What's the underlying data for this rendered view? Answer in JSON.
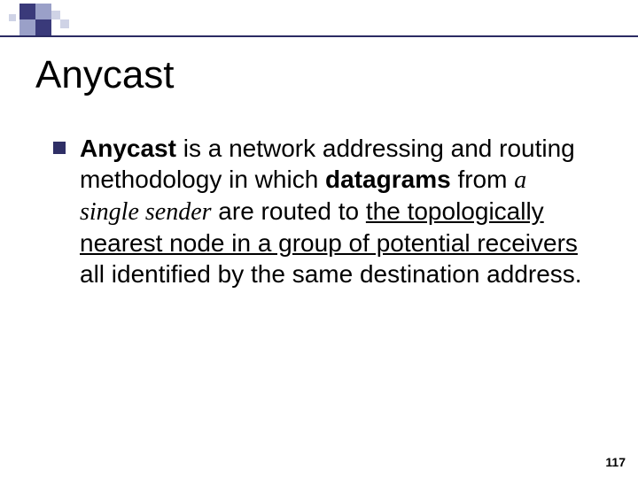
{
  "slide": {
    "title": "Anycast",
    "page_number": "117"
  },
  "bullet": {
    "s1": "Anycast",
    "s2": " is a network addressing and routing methodology in which ",
    "s3": "datagrams",
    "s4": " from ",
    "s5": "a single sender",
    "s6": " are routed to ",
    "s7": "the topologically nearest node in a group of potential receivers",
    "s8": " all identified by the same destination address."
  }
}
